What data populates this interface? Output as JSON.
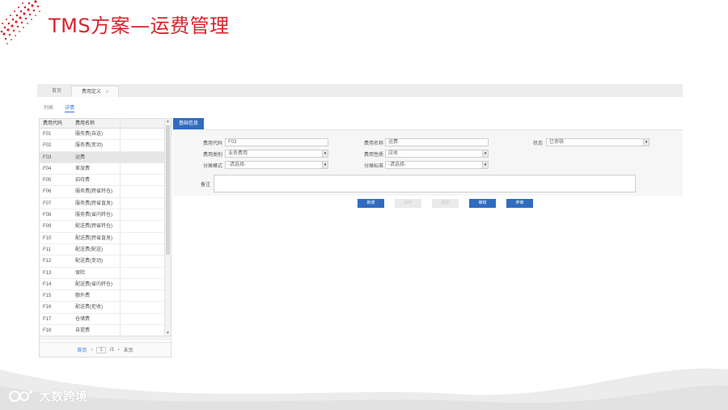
{
  "slide": {
    "title": "TMS方案—运费管理",
    "logo_text": "大数跨境",
    "accent": "#d9232d"
  },
  "app": {
    "tabs": [
      {
        "label": "首页"
      },
      {
        "label": "费用定义",
        "close": "x"
      }
    ],
    "subtabs": [
      {
        "label": "列表"
      },
      {
        "label": "详情"
      }
    ],
    "list": {
      "headers": [
        "费用代码",
        "费用名称"
      ],
      "rows": [
        {
          "code": "F01",
          "name": "服务费(自送)"
        },
        {
          "code": "F02",
          "name": "服务费(变动)"
        },
        {
          "code": "F03",
          "name": "运费"
        },
        {
          "code": "F04",
          "name": "差旅费"
        },
        {
          "code": "F05",
          "name": "招待费"
        },
        {
          "code": "F06",
          "name": "服务费(跨省转仓)"
        },
        {
          "code": "F07",
          "name": "服务费(跨省直发)"
        },
        {
          "code": "F08",
          "name": "服务费(省内转仓)"
        },
        {
          "code": "F09",
          "name": "配送费(跨省转仓)"
        },
        {
          "code": "F10",
          "name": "配送费(跨省直发)"
        },
        {
          "code": "F11",
          "name": "配送费(配送)"
        },
        {
          "code": "F12",
          "name": "配送费(变动)"
        },
        {
          "code": "F13",
          "name": "保险"
        },
        {
          "code": "F14",
          "name": "配送费(省内转仓)"
        },
        {
          "code": "F15",
          "name": "额外费"
        },
        {
          "code": "F16",
          "name": "配送费(拒收)"
        },
        {
          "code": "F17",
          "name": "仓储费"
        },
        {
          "code": "F18",
          "name": "自提费"
        }
      ],
      "selected_index": 2,
      "pager": {
        "first": "首页",
        "prev": "‹",
        "page": "1",
        "total": "/3",
        "next": "›",
        "last": "末页"
      }
    },
    "form": {
      "section": "基础信息",
      "fields": {
        "code_label": "费用代码",
        "code_value": "F03",
        "name_label": "费用名称",
        "name_value": "运费",
        "status_label": "状态",
        "status_value": "已审核",
        "category_label": "费用类别",
        "category_value": "业务费用",
        "nature_label": "费用性质",
        "nature_value": "应收",
        "alloc_mode_label": "分摊模式",
        "alloc_mode_value": "-请选择-",
        "alloc_std_label": "分摊标准",
        "alloc_std_value": "-请选择-",
        "remark_label": "备注"
      },
      "dropdown_arrow": "▾"
    },
    "buttons": [
      {
        "label": "新增",
        "enabled": true
      },
      {
        "label": "保存",
        "enabled": false
      },
      {
        "label": "删除",
        "enabled": false
      },
      {
        "label": "审核",
        "enabled": true
      },
      {
        "label": "弃审",
        "enabled": true
      }
    ]
  }
}
